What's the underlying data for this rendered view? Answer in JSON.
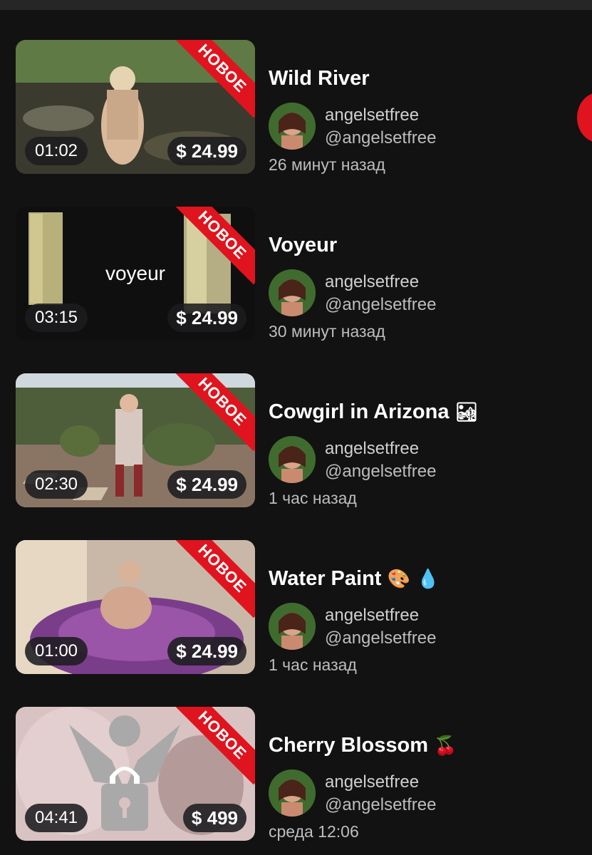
{
  "new_badge": "НОВОЕ",
  "items": [
    {
      "title": "Wild River",
      "emoji": "",
      "author": "angelsetfree",
      "handle": "@angelsetfree",
      "time": "26 минут назад",
      "duration": "01:02",
      "price": "$ 24.99",
      "thumb_text": ""
    },
    {
      "title": "Voyeur",
      "emoji": "",
      "author": "angelsetfree",
      "handle": "@angelsetfree",
      "time": "30 минут назад",
      "duration": "03:15",
      "price": "$ 24.99",
      "thumb_text": "voyeur"
    },
    {
      "title": "Cowgirl in Arizona",
      "emoji": "🏜",
      "author": "angelsetfree",
      "handle": "@angelsetfree",
      "time": "1 час назад",
      "duration": "02:30",
      "price": "$ 24.99",
      "thumb_text": ""
    },
    {
      "title": "Water Paint",
      "emoji": "🎨 💧",
      "author": "angelsetfree",
      "handle": "@angelsetfree",
      "time": "1 час назад",
      "duration": "01:00",
      "price": "$ 24.99",
      "thumb_text": ""
    },
    {
      "title": "Cherry Blossom",
      "emoji": "🍒",
      "author": "angelsetfree",
      "handle": "@angelsetfree",
      "time": "среда 12:06",
      "duration": "04:41",
      "price": "$ 499",
      "thumb_text": ""
    }
  ],
  "colors": {
    "accent": "#e0141e",
    "background": "#121212"
  }
}
